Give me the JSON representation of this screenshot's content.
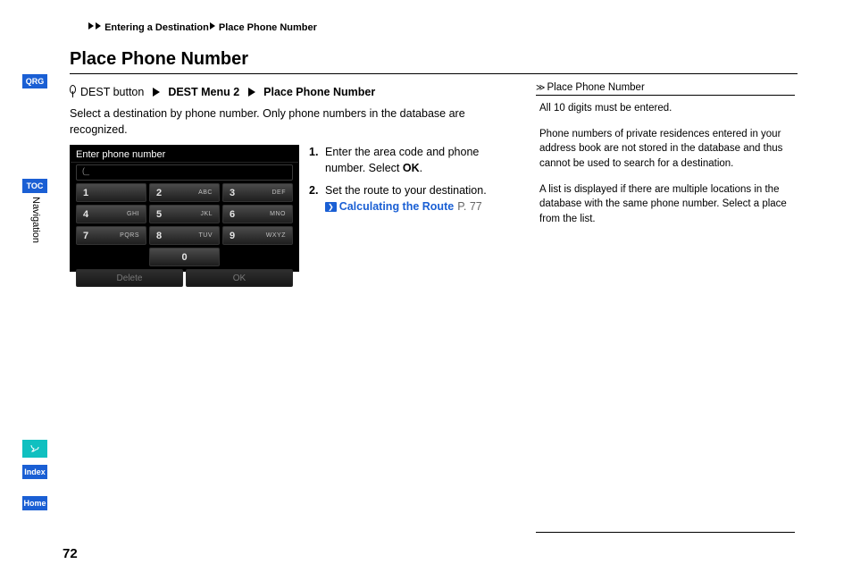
{
  "breadcrumb": {
    "level1": "Entering a Destination",
    "level2": "Place Phone Number"
  },
  "heading": "Place Phone Number",
  "path": {
    "start": "DEST button",
    "menu": "DEST Menu 2",
    "item": "Place Phone Number"
  },
  "body": "Select a destination by phone number. Only phone numbers in the database are recognized.",
  "steps": {
    "s1a": "Enter the area code and phone number. Select ",
    "s1b": "OK",
    "s1c": ".",
    "s2": "Set the route to your destination.",
    "link_label": "Calculating the Route",
    "link_page": "P. 77"
  },
  "sidebar_box": {
    "title": "Place Phone Number",
    "p1": "All 10 digits must be entered.",
    "p2": "Phone numbers of private residences entered in your address book are not stored in the database and thus cannot be used to search for a destination.",
    "p3": "A list is displayed if there are multiple locations in the database with the same phone number. Select a place from the list."
  },
  "keypad": {
    "title": "Enter phone number",
    "input": "(_",
    "keys": [
      {
        "d": "1",
        "l": ""
      },
      {
        "d": "2",
        "l": "ABC"
      },
      {
        "d": "3",
        "l": "DEF"
      },
      {
        "d": "4",
        "l": "GHI"
      },
      {
        "d": "5",
        "l": "JKL"
      },
      {
        "d": "6",
        "l": "MNO"
      },
      {
        "d": "7",
        "l": "PQRS"
      },
      {
        "d": "8",
        "l": "TUV"
      },
      {
        "d": "9",
        "l": "WXYZ"
      },
      {
        "d": "0",
        "l": ""
      }
    ],
    "delete": "Delete",
    "ok": "OK"
  },
  "tabs": {
    "qrg": "QRG",
    "toc": "TOC",
    "index": "Index",
    "home": "Home"
  },
  "vertical_nav": "Navigation",
  "page_number": "72"
}
